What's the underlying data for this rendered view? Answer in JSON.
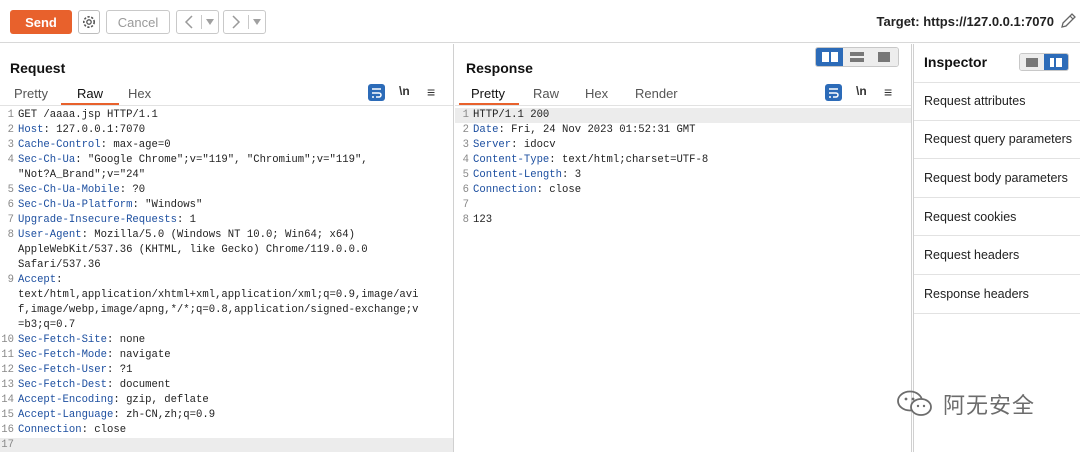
{
  "toolbar": {
    "send_label": "Send",
    "cancel_label": "Cancel",
    "target_text": "Target: https://127.0.0.1:7070",
    "icons": [
      "gear-icon",
      "back-arrow-icon",
      "forward-arrow-icon",
      "pencil-icon"
    ]
  },
  "request": {
    "title": "Request",
    "tabs": [
      "Pretty",
      "Raw",
      "Hex"
    ],
    "active_tab": "Raw",
    "tool_newline": "\\n",
    "lines": [
      {
        "n": "1",
        "h": "",
        "v": "GET /aaaa.jsp HTTP/1.1"
      },
      {
        "n": "2",
        "h": "Host",
        "v": ": 127.0.0.1:7070"
      },
      {
        "n": "3",
        "h": "Cache-Control",
        "v": ": max-age=0"
      },
      {
        "n": "4",
        "h": "Sec-Ch-Ua",
        "v": ": \"Google Chrome\";v=\"119\", \"Chromium\";v=\"119\","
      },
      {
        "n": "",
        "h": "",
        "v": "\"Not?A_Brand\";v=\"24\""
      },
      {
        "n": "5",
        "h": "Sec-Ch-Ua-Mobile",
        "v": ": ?0"
      },
      {
        "n": "6",
        "h": "Sec-Ch-Ua-Platform",
        "v": ": \"Windows\""
      },
      {
        "n": "7",
        "h": "Upgrade-Insecure-Requests",
        "v": ": 1"
      },
      {
        "n": "8",
        "h": "User-Agent",
        "v": ": Mozilla/5.0 (Windows NT 10.0; Win64; x64)"
      },
      {
        "n": "",
        "h": "",
        "v": "AppleWebKit/537.36 (KHTML, like Gecko) Chrome/119.0.0.0"
      },
      {
        "n": "",
        "h": "",
        "v": "Safari/537.36"
      },
      {
        "n": "9",
        "h": "Accept",
        "v": ":"
      },
      {
        "n": "",
        "h": "",
        "v": "text/html,application/xhtml+xml,application/xml;q=0.9,image/avi"
      },
      {
        "n": "",
        "h": "",
        "v": "f,image/webp,image/apng,*/*;q=0.8,application/signed-exchange;v"
      },
      {
        "n": "",
        "h": "",
        "v": "=b3;q=0.7"
      },
      {
        "n": "10",
        "h": "Sec-Fetch-Site",
        "v": ": none"
      },
      {
        "n": "11",
        "h": "Sec-Fetch-Mode",
        "v": ": navigate"
      },
      {
        "n": "12",
        "h": "Sec-Fetch-User",
        "v": ": ?1"
      },
      {
        "n": "13",
        "h": "Sec-Fetch-Dest",
        "v": ": document"
      },
      {
        "n": "14",
        "h": "Accept-Encoding",
        "v": ": gzip, deflate"
      },
      {
        "n": "15",
        "h": "Accept-Language",
        "v": ": zh-CN,zh;q=0.9"
      },
      {
        "n": "16",
        "h": "Connection",
        "v": ": close"
      },
      {
        "n": "17",
        "h": "",
        "v": ""
      }
    ]
  },
  "response": {
    "title": "Response",
    "tabs": [
      "Pretty",
      "Raw",
      "Hex",
      "Render"
    ],
    "active_tab": "Pretty",
    "tool_newline": "\\n",
    "lines": [
      {
        "n": "1",
        "h": "",
        "v": "HTTP/1.1 200"
      },
      {
        "n": "2",
        "h": "Date",
        "v": ": Fri, 24 Nov 2023 01:52:31 GMT"
      },
      {
        "n": "3",
        "h": "Server",
        "v": ": idocv"
      },
      {
        "n": "4",
        "h": "Content-Type",
        "v": ": text/html;charset=UTF-8"
      },
      {
        "n": "5",
        "h": "Content-Length",
        "v": ": 3"
      },
      {
        "n": "6",
        "h": "Connection",
        "v": ": close"
      },
      {
        "n": "7",
        "h": "",
        "v": ""
      },
      {
        "n": "8",
        "h": "",
        "v": "123"
      }
    ]
  },
  "inspector": {
    "title": "Inspector",
    "items": [
      "Request attributes",
      "Request query parameters",
      "Request body parameters",
      "Request cookies",
      "Request headers",
      "Response headers"
    ]
  },
  "watermark": {
    "text": "阿无安全"
  },
  "colors": {
    "accent": "#e8612c",
    "header_key": "#1d4fa0",
    "toggle_active": "#2c6bb8"
  }
}
